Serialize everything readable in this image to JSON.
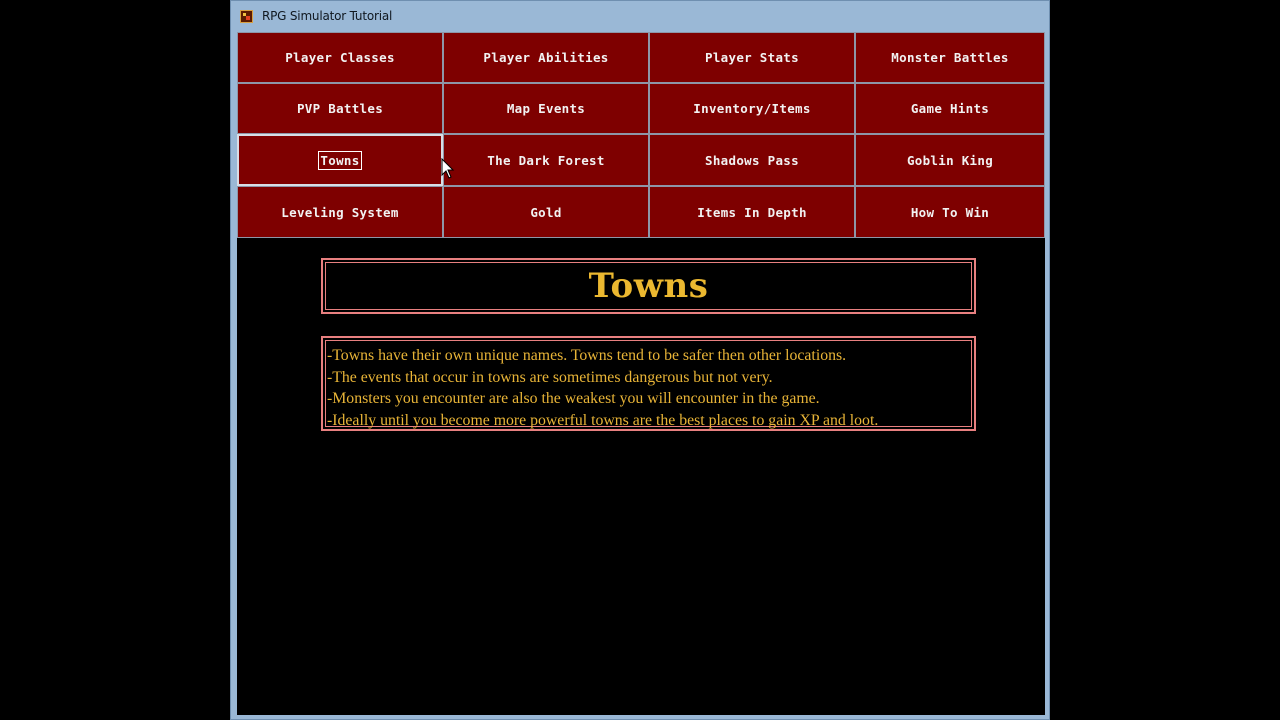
{
  "window": {
    "title": "RPG Simulator Tutorial",
    "icon": "app-icon"
  },
  "nav": {
    "buttons": [
      "Player Classes",
      "Player Abilities",
      "Player Stats",
      "Monster Battles",
      "PVP Battles",
      "Map Events",
      "Inventory/Items",
      "Game Hints",
      "Towns",
      "The Dark Forest",
      "Shadows Pass",
      "Goblin King",
      "Leveling System",
      "Gold",
      "Items In Depth",
      "How To Win"
    ],
    "selected": "Towns"
  },
  "content": {
    "title": "Towns",
    "lines": [
      "-Towns have their own unique names. Towns tend to be safer then other locations.",
      "-The events that occur in towns are sometimes dangerous but not very.",
      "-Monsters you encounter are also the weakest you will encounter in the game.",
      "-Ideally until you become more powerful towns are the best places to gain XP and loot."
    ]
  },
  "colors": {
    "button_bg": "#7e0000",
    "button_text": "#f2f2f2",
    "title_text": "#ebb830",
    "body_text": "#e8b437",
    "box_border": "#e88080",
    "background": "#000000",
    "window_frame": "#9ab8d6"
  }
}
